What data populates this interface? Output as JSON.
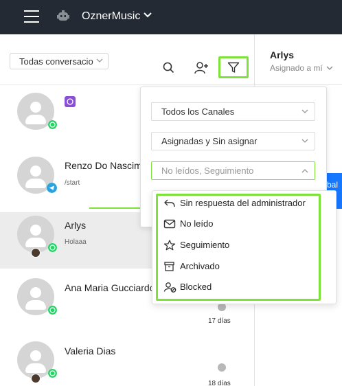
{
  "app": {
    "name": "OznerMusic"
  },
  "toolbar": {
    "conversation_filter": "Todas conversacio",
    "icons": [
      "search-icon",
      "add-user-icon",
      "filter-icon"
    ]
  },
  "conversations": [
    {
      "name": "",
      "preview": "",
      "channel": "whatsapp",
      "name_icon": "purple-emoji-icon"
    },
    {
      "name": "Renzo Do Nascim",
      "preview": "/start",
      "channel": "telegram"
    },
    {
      "name": "Arlys",
      "preview": "Holaaa",
      "channel": "whatsapp",
      "selected": true
    },
    {
      "name": "Ana Maria Gucciardo",
      "preview": "",
      "channel": "whatsapp",
      "time": "17 días"
    },
    {
      "name": "Valeria Dias",
      "preview": "",
      "channel": "whatsapp",
      "time": "18 días"
    }
  ],
  "filter_panel": {
    "channels": "Todos los Canales",
    "assignment": "Asignadas y Sin asignar",
    "status": "No leídos, Seguimiento"
  },
  "status_options": [
    {
      "label": "Sin respuesta del administrador",
      "icon": "reply-icon"
    },
    {
      "label": "No leído",
      "icon": "envelope-icon"
    },
    {
      "label": "Seguimiento",
      "icon": "star-icon"
    },
    {
      "label": "Archivado",
      "icon": "archive-icon"
    },
    {
      "label": "Blocked",
      "icon": "blocked-user-icon"
    }
  ],
  "contact": {
    "name": "Arlys",
    "assigned": "Asignado a mí",
    "button_text": "bal"
  },
  "colors": {
    "topbar": "#232a33",
    "highlight": "#7de33a",
    "whatsapp": "#25d366",
    "telegram": "#2aa3e0",
    "button_blue": "#1677ff"
  }
}
